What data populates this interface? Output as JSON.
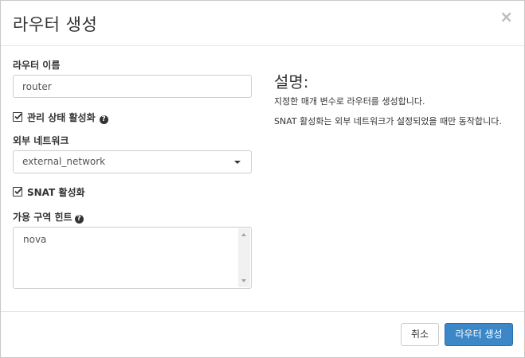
{
  "dialog": {
    "title": "라우터 생성",
    "close_glyph": "×"
  },
  "form": {
    "router_name": {
      "label": "라우터 이름",
      "value": "router"
    },
    "admin_state": {
      "label": "관리 상태 활성화",
      "checked": true
    },
    "external_network": {
      "label": "외부 네트워크",
      "selected": "external_network"
    },
    "enable_snat": {
      "label": "SNAT 활성화",
      "checked": true
    },
    "az_hints": {
      "label": "가용 구역 힌트",
      "options": [
        "nova"
      ]
    }
  },
  "description": {
    "title": "설명:",
    "paragraph1": "지정한 매개 변수로 라우터를 생성합니다.",
    "paragraph2": "SNAT 활성화는 외부 네트워크가 설정되었을 때만 동작합니다."
  },
  "footer": {
    "cancel_label": "취소",
    "submit_label": "라우터 생성"
  },
  "colors": {
    "primary": "#3b87c8",
    "primary_border": "#2e6da4",
    "close_icon": "#bdbdbd"
  },
  "icons": [
    "help-icon",
    "check-icon",
    "caret-down-icon",
    "close-icon",
    "scroll-up-icon",
    "scroll-down-icon"
  ]
}
